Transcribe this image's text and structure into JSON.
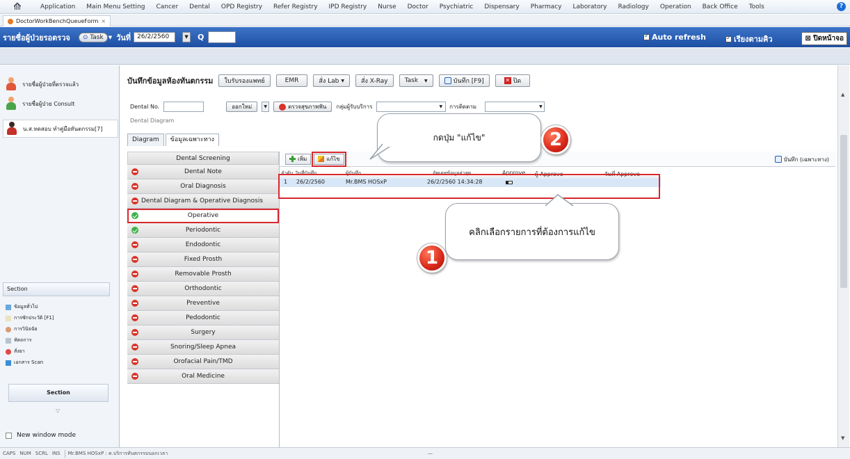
{
  "menubar": {
    "items": [
      "Application",
      "Main Menu Setting",
      "Cancer",
      "Dental",
      "OPD Registry",
      "Refer Registry",
      "IPD Registry",
      "Nurse",
      "Doctor",
      "Psychiatric",
      "Dispensary",
      "Pharmacy",
      "Laboratory",
      "Radiology",
      "Operation",
      "Back Office",
      "Tools"
    ],
    "help": "?"
  },
  "doc_tab": {
    "label": "DoctorWorkBenchQueueForm",
    "close": "×"
  },
  "bluebar": {
    "title": "รายชื่อผู้ป่วยรอตรวจ",
    "task": "Task",
    "date_label": "วันที่",
    "date_value": "26/2/2560",
    "q_label": "Q",
    "auto_refresh": "Auto refresh",
    "sort_queue": "เรียงตามคิว",
    "close_screen": "ปิดหน้าจอ"
  },
  "left": {
    "items": [
      {
        "label": "รายชื่อผู้ป่วยที่ตรวจแล้ว"
      },
      {
        "label": "รายชื่อผู้ป่วย Consult"
      },
      {
        "label": "น.ส.ทดสอบ ทำคู่มือทันตกรรม[7]"
      }
    ],
    "section_title": "Section",
    "section_items": [
      "ข้อมูลทั่วไป",
      "การซักประวัติ [F1]",
      "การวินิจฉัย",
      "หัตถการ",
      "สั่งยา",
      "เอกสาร Scan"
    ],
    "section_button": "Section",
    "new_window": "New window mode"
  },
  "main": {
    "title": "บันทึกข้อมูลห้องทันตกรรม",
    "buttons": {
      "refer_doctor": "ใบรับรองแพทย์",
      "emr": "EMR",
      "order_lab": "สั่ง Lab",
      "order_xray": "สั่ง X-Ray",
      "task": "Task",
      "save": "บันทึก [F9]",
      "close": "ปิด"
    },
    "dental_no_label": "Dental No.",
    "new_button": "ออกใหม่",
    "check_oral": "ตรวจสุขภาพฟัน",
    "service_group_label": "กลุ่มผู้รับบริการ",
    "followup_label": "การติดตาม",
    "dental_diagram_label": "Dental Diagram",
    "tabs": [
      "Diagram",
      "ข้อมูลเฉพาะทาง"
    ],
    "screening_header": "Dental Screening",
    "screen_items": [
      {
        "label": "Dental Note",
        "status": "red"
      },
      {
        "label": "Oral Diagnosis",
        "status": "red"
      },
      {
        "label": "Dental Diagram & Operative Diagnosis",
        "status": "red"
      },
      {
        "label": "Operative",
        "status": "green"
      },
      {
        "label": "Periodontic",
        "status": "green"
      },
      {
        "label": "Endodontic",
        "status": "red"
      },
      {
        "label": "Fixed Prosth",
        "status": "red"
      },
      {
        "label": "Removable Prosth",
        "status": "red"
      },
      {
        "label": "Orthodontic",
        "status": "red"
      },
      {
        "label": "Preventive",
        "status": "red"
      },
      {
        "label": "Pedodontic",
        "status": "red"
      },
      {
        "label": "Surgery",
        "status": "red"
      },
      {
        "label": "Snoring/Sleep Apnea",
        "status": "red"
      },
      {
        "label": "Orofacial Pain/TMD",
        "status": "red"
      },
      {
        "label": "Oral Medicine",
        "status": "red"
      }
    ],
    "grid": {
      "add_button": "เพิ่ม",
      "edit_button": "แก้ไข",
      "save_specific": "บันทึก (เฉพาะทาง)",
      "columns": [
        "ลำดับ",
        "วันที่บันทึก",
        "ผู้บันทึก",
        "อัพเดทข้อมูลล่าสุด",
        "Approve",
        "ผู้ Approve",
        "วันที่ Approve"
      ],
      "rows": [
        {
          "no": "1",
          "date": "26/2/2560",
          "recorder": "Mr.BMS HOSxP",
          "updated": "26/2/2560 14:34:28"
        }
      ]
    }
  },
  "callouts": {
    "step2": "กดปุ่ม \"แก้ไข\"",
    "step1": "คลิกเลือกรายการที่ต้องการแก้ไข",
    "badge1": "1",
    "badge2": "2"
  },
  "status": {
    "keys": [
      "CAPS",
      "NUM",
      "SCRL",
      "INS"
    ],
    "user": "Mr.BMS HOSxP : ค.บริการทันตกรรมนอกเวลา",
    "dash": "—"
  },
  "colors": {
    "accent": "#1d4fa2",
    "highlight": "#d8272c"
  }
}
